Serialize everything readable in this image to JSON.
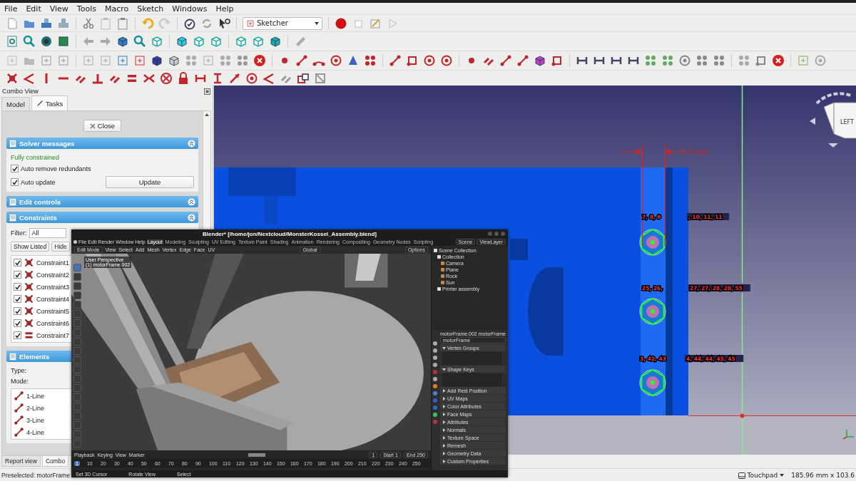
{
  "menu": [
    "File",
    "Edit",
    "View",
    "Tools",
    "Macro",
    "Sketch",
    "Windows",
    "Help"
  ],
  "workbench": {
    "value": "Sketcher"
  },
  "combo_view": {
    "title": "Combo View",
    "tabs": [
      {
        "label": "Model",
        "selected": false
      },
      {
        "label": "Tasks",
        "selected": true
      }
    ],
    "close_button": "Close",
    "solver": {
      "title": "Solver messages",
      "status": "Fully constrained",
      "checks": [
        {
          "label": "Auto remove redundants",
          "checked": true
        },
        {
          "label": "Auto update",
          "checked": true
        }
      ],
      "update_button": "Update"
    },
    "edit_controls": {
      "title": "Edit controls"
    },
    "constraints": {
      "title": "Constraints",
      "filter_label": "Filter:",
      "filter_value": "All",
      "buttons": [
        "Show Listed",
        "Hide"
      ],
      "items": [
        {
          "label": "Constraint1",
          "checked": true,
          "kind": "coincident"
        },
        {
          "label": "Constraint2",
          "checked": true,
          "kind": "coincident"
        },
        {
          "label": "Constraint3",
          "checked": true,
          "kind": "coincident"
        },
        {
          "label": "Constraint4",
          "checked": true,
          "kind": "coincident"
        },
        {
          "label": "Constraint5",
          "checked": true,
          "kind": "coincident"
        },
        {
          "label": "Constraint6",
          "checked": true,
          "kind": "coincident"
        },
        {
          "label": "Constraint7",
          "checked": true,
          "kind": "equal"
        }
      ]
    },
    "elements": {
      "title": "Elements",
      "type_label": "Type:",
      "mode_label": "Mode:",
      "items": [
        "1-Line",
        "2-Line",
        "3-Line",
        "4-Line"
      ]
    }
  },
  "bottom_tabs": [
    {
      "label": "Report view",
      "selected": false
    },
    {
      "label": "Combo",
      "selected": true
    }
  ],
  "viewport": {
    "dimension": "5.7 mm",
    "labels": [
      "7, 8, 9",
      ", 10, 11, 11",
      "25, 26,",
      "27, 27, 28, 28, 55",
      "3, 42, 43",
      "4, 44, 44, 45, 45"
    ],
    "nav_cube": "LEFT"
  },
  "status_bar": {
    "message": "Preselected: motorFrame",
    "input_mode": "Touchpad",
    "dimensions": "185.96 mm x 103.6"
  },
  "blender": {
    "title": "Blender* [/home/jon/Nextcloud/MonsterKossel_Assembly.blend]",
    "menu": [
      "File",
      "Edit",
      "Render",
      "Window",
      "Help"
    ],
    "workspaces": [
      {
        "label": "Layout",
        "selected": true
      },
      {
        "label": "Modeling",
        "selected": false
      },
      {
        "label": "Sculpting",
        "selected": false
      },
      {
        "label": "UV Editing",
        "selected": false
      },
      {
        "label": "Texture Paint",
        "selected": false
      },
      {
        "label": "Shading",
        "selected": false
      },
      {
        "label": "Animation",
        "selected": false
      },
      {
        "label": "Rendering",
        "selected": false
      },
      {
        "label": "Compositing",
        "selected": false
      },
      {
        "label": "Geometry Nodes",
        "selected": false
      },
      {
        "label": "Scripting",
        "selected": false
      }
    ],
    "scene": "Scene",
    "view_layer": "ViewLayer",
    "mode": "Edit Mode",
    "header_menu": [
      "View",
      "Select",
      "Add",
      "Mesh",
      "Vertex",
      "Edge",
      "Face",
      "UV"
    ],
    "orientation": "Global",
    "options": "Options",
    "view_info": [
      "User Perspective",
      "(1) motorFrame.002"
    ],
    "outliner": {
      "root": "Scene Collection",
      "items": [
        {
          "label": "Collection",
          "children": [
            {
              "label": "Camera"
            },
            {
              "label": "Plane"
            },
            {
              "label": "Rock"
            },
            {
              "label": "Sun"
            }
          ]
        },
        {
          "label": "Printer assembly"
        }
      ]
    },
    "properties": {
      "object": "motorFrame.002",
      "data": "motorFrame",
      "mesh_name": "motorFrame",
      "sections": [
        {
          "label": "Vertex Groups",
          "expanded": true
        },
        {
          "label": "Shape Keys",
          "expanded": true
        },
        {
          "label": "Add Rest Position",
          "expanded": false
        },
        {
          "label": "UV Maps",
          "expanded": false
        },
        {
          "label": "Color Attributes",
          "expanded": false
        },
        {
          "label": "Face Maps",
          "expanded": false
        },
        {
          "label": "Attributes",
          "expanded": false
        },
        {
          "label": "Normals",
          "expanded": false
        },
        {
          "label": "Texture Space",
          "expanded": false
        },
        {
          "label": "Remesh",
          "expanded": false
        },
        {
          "label": "Geometry Data",
          "expanded": false
        },
        {
          "label": "Custom Properties",
          "expanded": false
        }
      ]
    },
    "timeline": {
      "menu": [
        "Playback",
        "Keying",
        "View",
        "Marker"
      ],
      "current": "1",
      "ticks": [
        "10",
        "20",
        "30",
        "40",
        "50",
        "60",
        "70",
        "80",
        "90",
        "100",
        "110",
        "120",
        "130",
        "140",
        "150",
        "160",
        "170",
        "180",
        "190",
        "200",
        "210",
        "220",
        "230",
        "240",
        "250"
      ],
      "frame": "1",
      "start_label": "Start",
      "start": "1",
      "end_label": "End",
      "end": "250"
    },
    "status": [
      "Set 3D Cursor",
      "Rotate View",
      "Select"
    ]
  }
}
